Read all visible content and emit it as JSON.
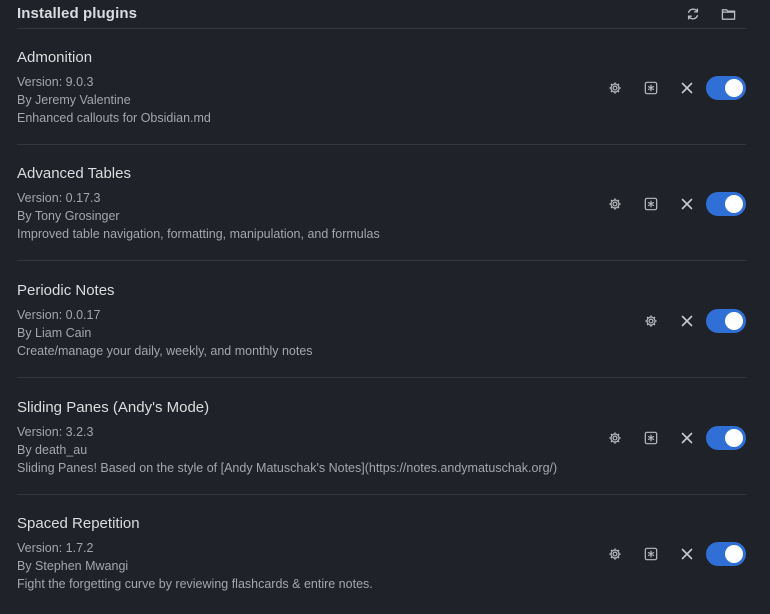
{
  "header": {
    "title": "Installed plugins",
    "icons": [
      "reload-icon",
      "folder-icon"
    ]
  },
  "plugins": [
    {
      "name": "Admonition",
      "version": "Version: 9.0.3",
      "author": "By Jeremy Valentine",
      "description": "Enhanced callouts for Obsidian.md",
      "has_settings": true,
      "has_hotkeys": true,
      "enabled": true
    },
    {
      "name": "Advanced Tables",
      "version": "Version: 0.17.3",
      "author": "By Tony Grosinger",
      "description": "Improved table navigation, formatting, manipulation, and formulas",
      "has_settings": true,
      "has_hotkeys": true,
      "enabled": true
    },
    {
      "name": "Periodic Notes",
      "version": "Version: 0.0.17",
      "author": "By Liam Cain",
      "description": "Create/manage your daily, weekly, and monthly notes",
      "has_settings": false,
      "has_hotkeys": true,
      "enabled": true
    },
    {
      "name": "Sliding Panes (Andy's Mode)",
      "version": "Version: 3.2.3",
      "author": "By death_au",
      "description": "Sliding Panes! Based on the style of [Andy Matuschak's Notes](https://notes.andymatuschak.org/)",
      "has_settings": true,
      "has_hotkeys": true,
      "enabled": true
    },
    {
      "name": "Spaced Repetition",
      "version": "Version: 1.7.2",
      "author": "By Stephen Mwangi",
      "description": "Fight the forgetting curve by reviewing flashcards & entire notes.",
      "has_settings": true,
      "has_hotkeys": true,
      "enabled": true
    }
  ],
  "colors": {
    "background": "#1f2228",
    "toggle_on": "#2f6fd6",
    "divider": "#33373e",
    "text_primary": "#dcddde",
    "text_muted": "#a3a6ab"
  }
}
